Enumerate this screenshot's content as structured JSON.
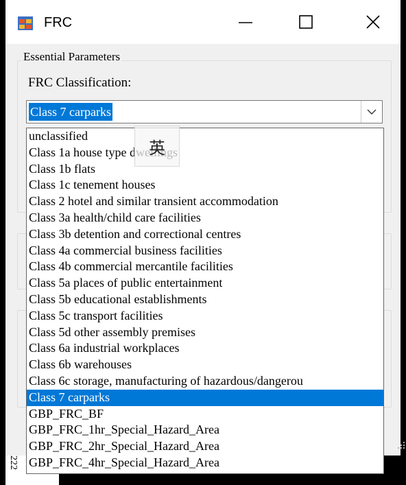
{
  "window": {
    "title": "FRC",
    "icon": "form-app-icon",
    "controls": [
      "minimize-icon",
      "maximize-icon",
      "close-icon"
    ]
  },
  "group": {
    "legend": "Essential Parameters"
  },
  "field": {
    "label": "FRC Classification:",
    "selected_value": "Class 7 carparks"
  },
  "dropdown": {
    "items": [
      "unclassified",
      "Class 1a house type dwellings",
      "Class 1b flats",
      "Class 1c tenement houses",
      "Class 2 hotel and similar transient accommodation",
      "Class 3a health/child care facilities",
      "Class 3b detention and correctional centres",
      "Class 4a commercial business facilities",
      "Class 4b commercial mercantile facilities",
      "Class 5a places of public entertainment",
      "Class 5b educational establishments",
      "Class 5c transport facilities",
      "Class 5d other assembly premises",
      "Class 6a industrial workplaces",
      "Class 6b warehouses",
      "Class 6c storage, manufacturing of hazardous/dangerou",
      "Class 7 carparks",
      "GBP_FRC_BF",
      "GBP_FRC_1hr_Special_Hazard_Area",
      "GBP_FRC_2hr_Special_Hazard_Area",
      "GBP_FRC_4hr_Special_Hazard_Area"
    ],
    "selected_index": 16
  },
  "ime_indicator": "英",
  "background_text": "222",
  "colors": {
    "selection": "#0078d7",
    "window_bg": "#f0f0f0",
    "titlebar_bg": "#ffffff"
  }
}
